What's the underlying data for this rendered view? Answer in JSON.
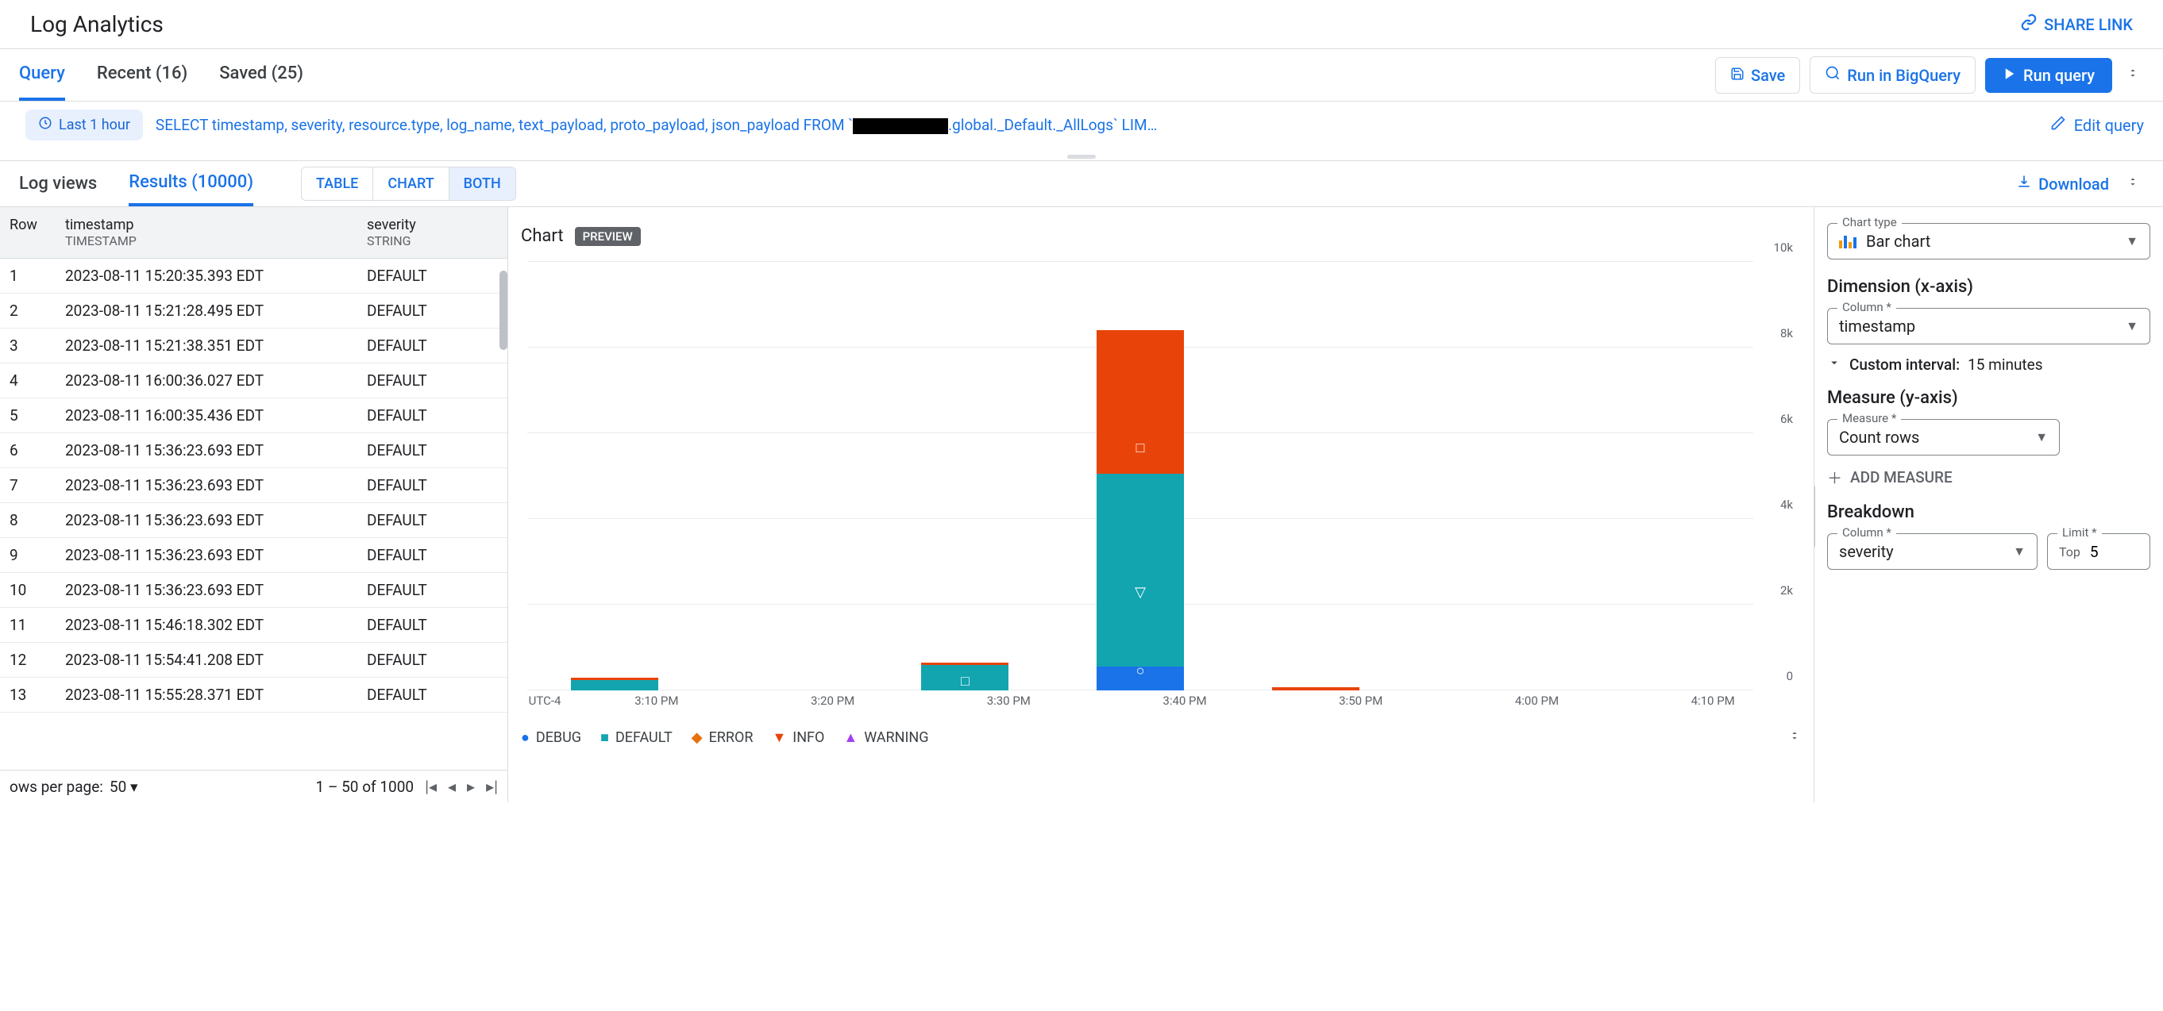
{
  "header": {
    "title": "Log Analytics",
    "share_label": "SHARE LINK"
  },
  "tabs": {
    "query": "Query",
    "recent": "Recent (16)",
    "saved": "Saved (25)"
  },
  "actions": {
    "save": "Save",
    "run_bq": "Run in BigQuery",
    "run_query": "Run query"
  },
  "query_bar": {
    "time_chip": "Last 1 hour",
    "sql_before": "SELECT timestamp, severity, resource.type, log_name, text_payload, proto_payload, json_payload FROM `",
    "sql_after": ".global._Default._AllLogs` LIM…",
    "edit_label": "Edit query"
  },
  "results_tabs": {
    "log_views": "Log views",
    "results": "Results (10000)",
    "seg_table": "TABLE",
    "seg_chart": "CHART",
    "seg_both": "BOTH",
    "download": "Download"
  },
  "table": {
    "cols": {
      "row": "Row",
      "ts": "timestamp",
      "ts_type": "TIMESTAMP",
      "sev": "severity",
      "sev_type": "STRING"
    },
    "rows": [
      {
        "i": "1",
        "ts": "2023-08-11 15:20:35.393 EDT",
        "sev": "DEFAULT"
      },
      {
        "i": "2",
        "ts": "2023-08-11 15:21:28.495 EDT",
        "sev": "DEFAULT"
      },
      {
        "i": "3",
        "ts": "2023-08-11 15:21:38.351 EDT",
        "sev": "DEFAULT"
      },
      {
        "i": "4",
        "ts": "2023-08-11 16:00:36.027 EDT",
        "sev": "DEFAULT"
      },
      {
        "i": "5",
        "ts": "2023-08-11 16:00:35.436 EDT",
        "sev": "DEFAULT"
      },
      {
        "i": "6",
        "ts": "2023-08-11 15:36:23.693 EDT",
        "sev": "DEFAULT"
      },
      {
        "i": "7",
        "ts": "2023-08-11 15:36:23.693 EDT",
        "sev": "DEFAULT"
      },
      {
        "i": "8",
        "ts": "2023-08-11 15:36:23.693 EDT",
        "sev": "DEFAULT"
      },
      {
        "i": "9",
        "ts": "2023-08-11 15:36:23.693 EDT",
        "sev": "DEFAULT"
      },
      {
        "i": "10",
        "ts": "2023-08-11 15:36:23.693 EDT",
        "sev": "DEFAULT"
      },
      {
        "i": "11",
        "ts": "2023-08-11 15:46:18.302 EDT",
        "sev": "DEFAULT"
      },
      {
        "i": "12",
        "ts": "2023-08-11 15:54:41.208 EDT",
        "sev": "DEFAULT"
      },
      {
        "i": "13",
        "ts": "2023-08-11 15:55:28.371 EDT",
        "sev": "DEFAULT"
      }
    ],
    "pager": {
      "rpp_label": "ows per page:",
      "rpp_value": "50",
      "range": "1 – 50 of 1000"
    }
  },
  "chart": {
    "title": "Chart",
    "badge": "PREVIEW",
    "tz_label": "UTC-4"
  },
  "chart_data": {
    "type": "bar",
    "stacked": true,
    "xlabel": "",
    "ylabel": "",
    "ylim": [
      0,
      10000
    ],
    "yticks": [
      "0",
      "2k",
      "4k",
      "6k",
      "8k",
      "10k"
    ],
    "categories": [
      "3:10 PM",
      "3:20 PM",
      "3:30 PM",
      "3:40 PM",
      "3:50 PM",
      "4:00 PM",
      "4:10 PM"
    ],
    "series": [
      {
        "name": "DEBUG",
        "color": "#1a73e8",
        "values": [
          0,
          0,
          0,
          550,
          0,
          0,
          0
        ]
      },
      {
        "name": "DEFAULT",
        "color": "#12a4af",
        "values": [
          250,
          0,
          600,
          4500,
          0,
          0,
          0
        ]
      },
      {
        "name": "ERROR",
        "color": "#e8710a",
        "values": [
          0,
          0,
          0,
          0,
          0,
          0,
          0
        ]
      },
      {
        "name": "INFO",
        "color": "#e8440a",
        "values": [
          50,
          0,
          50,
          3350,
          80,
          0,
          0
        ]
      },
      {
        "name": "WARNING",
        "color": "#a142f4",
        "values": [
          0,
          0,
          0,
          0,
          0,
          0,
          0
        ]
      }
    ],
    "legend_shapes": [
      "●",
      "■",
      "◆",
      "▼",
      "▲"
    ]
  },
  "config": {
    "chart_type_label": "Chart type",
    "chart_type_value": "Bar chart",
    "dimension_heading": "Dimension (x-axis)",
    "column_label": "Column *",
    "column_value": "timestamp",
    "custom_interval_label": "Custom interval:",
    "custom_interval_value": "15 minutes",
    "measure_heading": "Measure (y-axis)",
    "measure_label": "Measure *",
    "measure_value": "Count rows",
    "add_measure": "ADD MEASURE",
    "breakdown_heading": "Breakdown",
    "breakdown_column_label": "Column *",
    "breakdown_column_value": "severity",
    "limit_label": "Limit *",
    "limit_prefix": "Top",
    "limit_value": "5"
  }
}
